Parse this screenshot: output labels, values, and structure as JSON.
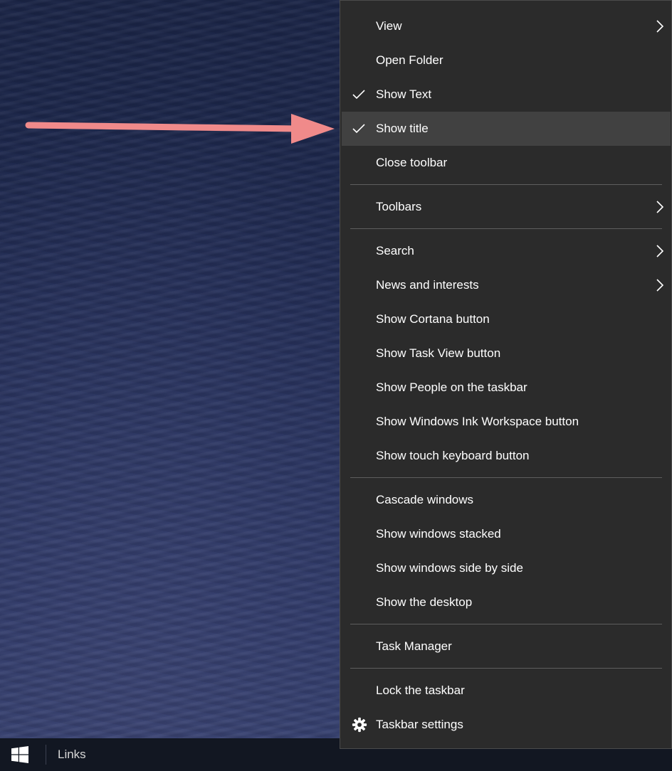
{
  "desktop": {
    "wallpaper_description": "dark blue rippled sand dunes",
    "annotation_arrow_color": "#f08a8a"
  },
  "taskbar": {
    "start_icon": "windows-logo-icon",
    "links_label": "Links"
  },
  "context_menu": {
    "items": [
      {
        "label": "View",
        "checked": false,
        "submenu": true
      },
      {
        "label": "Open Folder",
        "checked": false,
        "submenu": false
      },
      {
        "label": "Show Text",
        "checked": true,
        "submenu": false
      },
      {
        "label": "Show title",
        "checked": true,
        "submenu": false,
        "highlighted": true
      },
      {
        "label": "Close toolbar",
        "checked": false,
        "submenu": false
      },
      {
        "label": "Toolbars",
        "checked": false,
        "submenu": true
      },
      {
        "label": "Search",
        "checked": false,
        "submenu": true
      },
      {
        "label": "News and interests",
        "checked": false,
        "submenu": true
      },
      {
        "label": "Show Cortana button",
        "checked": false,
        "submenu": false
      },
      {
        "label": "Show Task View button",
        "checked": false,
        "submenu": false
      },
      {
        "label": "Show People on the taskbar",
        "checked": false,
        "submenu": false
      },
      {
        "label": "Show Windows Ink Workspace button",
        "checked": false,
        "submenu": false
      },
      {
        "label": "Show touch keyboard button",
        "checked": false,
        "submenu": false
      },
      {
        "label": "Cascade windows",
        "checked": false,
        "submenu": false
      },
      {
        "label": "Show windows stacked",
        "checked": false,
        "submenu": false
      },
      {
        "label": "Show windows side by side",
        "checked": false,
        "submenu": false
      },
      {
        "label": "Show the desktop",
        "checked": false,
        "submenu": false
      },
      {
        "label": "Task Manager",
        "checked": false,
        "submenu": false
      },
      {
        "label": "Lock the taskbar",
        "checked": false,
        "submenu": false
      },
      {
        "label": "Taskbar settings",
        "checked": false,
        "submenu": false,
        "icon": "gear-icon"
      }
    ],
    "colors": {
      "background": "#2b2b2b",
      "highlight": "#414141",
      "separator": "#5e5e5e",
      "text": "#ffffff"
    }
  }
}
